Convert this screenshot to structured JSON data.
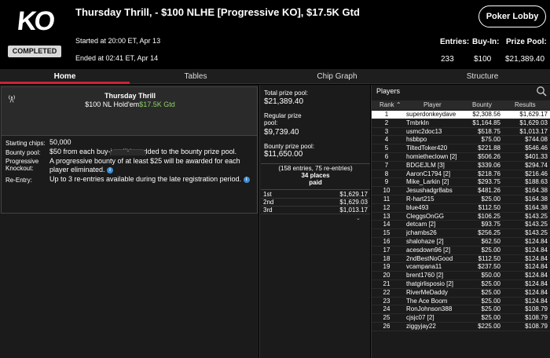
{
  "header": {
    "logo_text": "KO",
    "status_badge": "COMPLETED",
    "title": "Thursday Thrill, - $100 NLHE [Progressive KO], $17.5K Gtd",
    "started": "Started at 20:00 ET, Apr 13",
    "ended": "Ended at 02:41 ET, Apr 14",
    "lobby_button": "Poker Lobby",
    "entries_label": "Entries:",
    "entries_value": "233",
    "buyin_label": "Buy-In:",
    "buyin_value": "$100",
    "prizepool_label": "Prize Pool:",
    "prizepool_value": "$21,389.40"
  },
  "tabs": [
    {
      "label": "Home",
      "active": true
    },
    {
      "label": "Tables",
      "active": false
    },
    {
      "label": "Chip Graph",
      "active": false
    },
    {
      "label": "Structure",
      "active": false
    }
  ],
  "game": {
    "name": "Thursday Thrill",
    "sub_prefix": "$100 NL Hold'em",
    "sub_gtd": "$17.5K Gtd",
    "broadcast_icon": "broadcast-icon"
  },
  "details": {
    "starting_chips_label": "Starting chips:",
    "starting_chips_value": "50,000",
    "bounty_pool_label": "Bounty pool:",
    "bounty_pool_value": "$50 from each buy-in will be added to the bounty prize pool.",
    "progressive_label": "Progressive Knockout:",
    "progressive_value": "A progressive bounty of at least $25 will be awarded for each player eliminated.",
    "reentry_label": "Re-Entry:",
    "reentry_value": "Up to 3 re-entries available during the late registration period."
  },
  "prizes": {
    "total_label": "Total prize pool:",
    "total_value": "$21,389.40",
    "regular_label": "Regular prize pool:",
    "regular_value": "$9,739.40",
    "bounty_label": "Bounty prize pool:",
    "bounty_value": "$11,650.00",
    "entries_note": "(158 entries, 75 re-entries)",
    "places_paid": "34 places",
    "paid_label": "paid",
    "places": [
      {
        "place": "1st",
        "amount": "$1,629.17"
      },
      {
        "place": "2nd",
        "amount": "$1,629.03"
      },
      {
        "place": "3rd",
        "amount": "$1,013.17"
      }
    ]
  },
  "players": {
    "title": "Players",
    "columns": {
      "rank": "Rank",
      "player": "Player",
      "bounty": "Bounty",
      "results": "Results"
    },
    "rows": [
      {
        "rank": "1",
        "player": "superdonkeydave",
        "bounty": "$2,308.56",
        "results": "$1,629.17"
      },
      {
        "rank": "2",
        "player": "Tmbrkln",
        "bounty": "$1,164.85",
        "results": "$1,629.03"
      },
      {
        "rank": "3",
        "player": "usmc2doc13",
        "bounty": "$518.75",
        "results": "$1,013.17"
      },
      {
        "rank": "4",
        "player": "hsbbpo",
        "bounty": "$75.00",
        "results": "$744.08"
      },
      {
        "rank": "5",
        "player": "TiltedToker420",
        "bounty": "$221.88",
        "results": "$546.46"
      },
      {
        "rank": "6",
        "player": "homietheclown [2]",
        "bounty": "$506.26",
        "results": "$401.33"
      },
      {
        "rank": "7",
        "player": "BDGEJLM [3]",
        "bounty": "$339.06",
        "results": "$294.74"
      },
      {
        "rank": "8",
        "player": "AaronC1794 [2]",
        "bounty": "$218.76",
        "results": "$216.46"
      },
      {
        "rank": "9",
        "player": "Mike_Larkin [2]",
        "bounty": "$293.75",
        "results": "$188.63"
      },
      {
        "rank": "10",
        "player": "Jesushadgr8abs",
        "bounty": "$481.26",
        "results": "$164.38"
      },
      {
        "rank": "11",
        "player": "R-hart215",
        "bounty": "$25.00",
        "results": "$164.38"
      },
      {
        "rank": "12",
        "player": "blue493",
        "bounty": "$112.50",
        "results": "$164.38"
      },
      {
        "rank": "13",
        "player": "CleggsOnGG",
        "bounty": "$106.25",
        "results": "$143.25"
      },
      {
        "rank": "14",
        "player": "detcam [2]",
        "bounty": "$93.75",
        "results": "$143.25"
      },
      {
        "rank": "15",
        "player": "jchambs26",
        "bounty": "$256.25",
        "results": "$143.25"
      },
      {
        "rank": "16",
        "player": "shalohaze [2]",
        "bounty": "$62.50",
        "results": "$124.84"
      },
      {
        "rank": "17",
        "player": "acesdown96 [2]",
        "bounty": "$25.00",
        "results": "$124.84"
      },
      {
        "rank": "18",
        "player": "2ndBestNoGood",
        "bounty": "$112.50",
        "results": "$124.84"
      },
      {
        "rank": "19",
        "player": "vcampana11",
        "bounty": "$237.50",
        "results": "$124.84"
      },
      {
        "rank": "20",
        "player": "brent1760 [2]",
        "bounty": "$50.00",
        "results": "$124.84"
      },
      {
        "rank": "21",
        "player": "thatgirlisposio [2]",
        "bounty": "$25.00",
        "results": "$124.84"
      },
      {
        "rank": "22",
        "player": "RiverMeDaddy",
        "bounty": "$25.00",
        "results": "$124.84"
      },
      {
        "rank": "23",
        "player": "The Ace Boom",
        "bounty": "$25.00",
        "results": "$124.84"
      },
      {
        "rank": "24",
        "player": "RonJohnson388",
        "bounty": "$25.00",
        "results": "$108.79"
      },
      {
        "rank": "25",
        "player": "cjsjc07 [2]",
        "bounty": "$25.00",
        "results": "$108.79"
      },
      {
        "rank": "26",
        "player": "ziggyjay22",
        "bounty": "$225.00",
        "results": "$108.79"
      }
    ]
  }
}
